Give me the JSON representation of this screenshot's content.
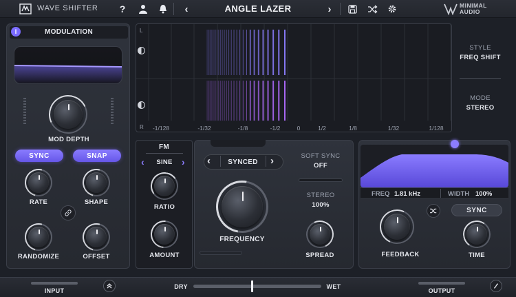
{
  "header": {
    "app_name": "WAVE SHIFTER",
    "preset_name": "ANGLE LAZER",
    "brand_line1": "MINIMAL",
    "brand_line2": "AUDIO"
  },
  "spectrum": {
    "left_labels": [
      "L",
      "R"
    ],
    "axis_labels": [
      "-1/128",
      "-1/32",
      "-1/8",
      "-1/2",
      "0",
      "1/2",
      "1/8",
      "1/32",
      "1/128"
    ],
    "style_label": "STYLE",
    "style_value": "FREQ SHIFT",
    "mode_label": "MODE",
    "mode_value": "STEREO"
  },
  "modulation": {
    "title": "MODULATION",
    "mod_depth_label": "MOD DEPTH",
    "sync_label": "SYNC",
    "snap_label": "SNAP",
    "rate_label": "RATE",
    "shape_label": "SHAPE",
    "randomize_label": "RANDOMIZE",
    "offset_label": "OFFSET"
  },
  "fm": {
    "title": "FM",
    "waveform": "SINE",
    "ratio_label": "RATIO",
    "amount_label": "AMOUNT"
  },
  "center": {
    "sync_mode": "SYNCED",
    "soft_sync_label": "SOFT SYNC",
    "soft_sync_value": "OFF",
    "stereo_label": "STEREO",
    "stereo_value": "100%",
    "frequency_label": "FREQUENCY",
    "spread_label": "SPREAD"
  },
  "delay": {
    "freq_label": "FREQ",
    "freq_value": "1.81 kHz",
    "width_label": "WIDTH",
    "width_value": "100%",
    "sync_label": "SYNC",
    "feedback_label": "FEEDBACK",
    "time_label": "TIME"
  },
  "footer": {
    "input_label": "INPUT",
    "dry_label": "DRY",
    "wet_label": "WET",
    "output_label": "OUTPUT",
    "drywet_level": 0.45
  },
  "colors": {
    "accent": "#7b6cff",
    "purple_bar": "#b06cff",
    "blue_bar": "#8c7dff"
  }
}
